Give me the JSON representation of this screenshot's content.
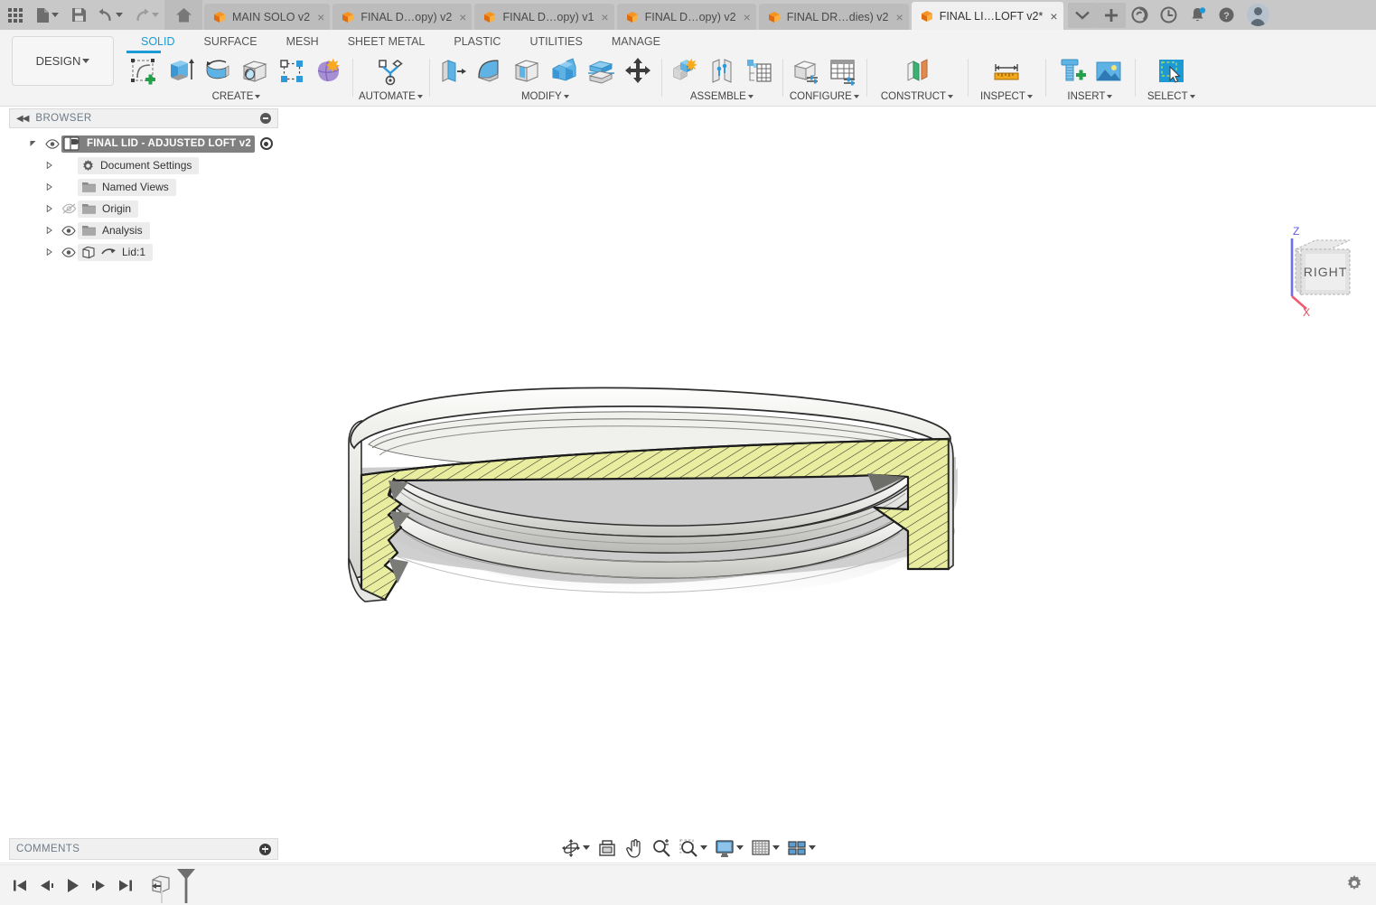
{
  "app": {
    "title": "Fusion 360",
    "accent_blue": "#1b9ad6",
    "chrome_gray": "#c8c8c8",
    "ribbon_bg": "#f3f3f3"
  },
  "quick_access": {
    "app_grid_label": "app-grid",
    "new_label": "New",
    "save_label": "Save",
    "undo_label": "Undo",
    "redo_label": "Redo",
    "home_label": "Home"
  },
  "tabs": [
    {
      "label": "MAIN SOLO v2",
      "active": false,
      "close": "×"
    },
    {
      "label": "FINAL D…opy) v2",
      "active": false,
      "close": "×"
    },
    {
      "label": "FINAL D…opy) v1",
      "active": false,
      "close": "×"
    },
    {
      "label": "FINAL D…opy) v2",
      "active": false,
      "close": "×"
    },
    {
      "label": "FINAL DR…dies) v2",
      "active": false,
      "close": "×"
    },
    {
      "label": "FINAL LI…LOFT v2*",
      "active": true,
      "close": "×"
    }
  ],
  "tab_overflow": {
    "chevron_label": "More tabs",
    "add_label": "New design"
  },
  "account_bar": {
    "extension_label": "Extensions",
    "recent_label": "Recent",
    "notifications_label": "Notifications",
    "help_label": "Help",
    "profile_label": "Account"
  },
  "design_menu": {
    "label": "DESIGN"
  },
  "ribbon_tabs": [
    {
      "label": "SOLID",
      "active": true
    },
    {
      "label": "SURFACE",
      "active": false
    },
    {
      "label": "MESH",
      "active": false
    },
    {
      "label": "SHEET METAL",
      "active": false
    },
    {
      "label": "PLASTIC",
      "active": false
    },
    {
      "label": "UTILITIES",
      "active": false
    },
    {
      "label": "MANAGE",
      "active": false
    }
  ],
  "ribbon_panels": [
    {
      "label": "CREATE",
      "has_caret": true,
      "tools": [
        {
          "name": "create-sketch",
          "label": "Create Sketch"
        },
        {
          "name": "extrude",
          "label": "Extrude"
        },
        {
          "name": "revolve",
          "label": "Revolve"
        },
        {
          "name": "hole",
          "label": "Hole"
        },
        {
          "name": "rectangular-pattern",
          "label": "Rectangular Pattern"
        },
        {
          "name": "form",
          "label": "Create Form"
        }
      ]
    },
    {
      "label": "AUTOMATE",
      "has_caret": true,
      "tools": [
        {
          "name": "automate",
          "label": "Automated Modeling"
        }
      ]
    },
    {
      "label": "MODIFY",
      "has_caret": true,
      "tools": [
        {
          "name": "press-pull",
          "label": "Press Pull"
        },
        {
          "name": "fillet",
          "label": "Fillet"
        },
        {
          "name": "shell",
          "label": "Shell"
        },
        {
          "name": "combine",
          "label": "Combine"
        },
        {
          "name": "split-body",
          "label": "Split Body"
        },
        {
          "name": "move-copy",
          "label": "Move/Copy"
        }
      ]
    },
    {
      "label": "ASSEMBLE",
      "has_caret": true,
      "tools": [
        {
          "name": "new-component",
          "label": "New Component"
        },
        {
          "name": "joint",
          "label": "Joint"
        },
        {
          "name": "bill-of-materials",
          "label": "Bill of Materials"
        }
      ]
    },
    {
      "label": "CONFIGURE",
      "has_caret": true,
      "tools": [
        {
          "name": "create-configuration",
          "label": "Create Configuration"
        },
        {
          "name": "configuration-table",
          "label": "Configuration Table"
        }
      ]
    },
    {
      "label": "CONSTRUCT",
      "has_caret": true,
      "tools": [
        {
          "name": "offset-plane",
          "label": "Offset Plane"
        }
      ]
    },
    {
      "label": "INSPECT",
      "has_caret": true,
      "tools": [
        {
          "name": "measure",
          "label": "Measure"
        }
      ]
    },
    {
      "label": "INSERT",
      "has_caret": true,
      "tools": [
        {
          "name": "insert-mcmaster-carr",
          "label": "Insert McMaster-Carr Component"
        },
        {
          "name": "canvas",
          "label": "Canvas"
        }
      ]
    },
    {
      "label": "SELECT",
      "has_caret": true,
      "tools": [
        {
          "name": "select",
          "label": "Select"
        }
      ]
    }
  ],
  "browser": {
    "title": "BROWSER",
    "collapse_label": "◀◀",
    "tree": [
      {
        "label": "FINAL LID - ADJUSTED LOFT v2",
        "level": 0,
        "icon": "component-icon",
        "visible": true,
        "has_radio": true,
        "expanded": true,
        "root": true
      },
      {
        "label": "Document Settings",
        "level": 1,
        "icon": "gear-icon",
        "visible": null,
        "expanded": false
      },
      {
        "label": "Named Views",
        "level": 1,
        "icon": "folder-icon",
        "visible": null,
        "expanded": false
      },
      {
        "label": "Origin",
        "level": 1,
        "icon": "folder-icon",
        "visible": false,
        "expanded": false
      },
      {
        "label": "Analysis",
        "level": 1,
        "icon": "folder-icon",
        "visible": true,
        "expanded": false
      },
      {
        "label": "Lid:1",
        "level": 1,
        "icon": "body-icon",
        "visible": true,
        "expanded": false,
        "has_joint": true
      }
    ]
  },
  "viewcube": {
    "face_label": "RIGHT",
    "axis_z": "Z",
    "axis_x": "X"
  },
  "model": {
    "name": "lid-section-view",
    "description": "Sectioned circular lid with threaded inner profile",
    "section_fill": "#e9eda0",
    "body_fill": "#f2f2f0",
    "shadow": "#cccccc"
  },
  "nav_toolbar": [
    {
      "name": "orbit-icon",
      "label": "Orbit",
      "caret": true
    },
    {
      "name": "look-at-icon",
      "label": "Look At",
      "caret": false
    },
    {
      "name": "pan-icon",
      "label": "Pan",
      "caret": false
    },
    {
      "name": "zoom-icon",
      "label": "Zoom",
      "caret": false
    },
    {
      "name": "zoom-window-icon",
      "label": "Fit",
      "caret": true
    },
    {
      "name": "display-settings-icon",
      "label": "Display Settings",
      "caret": true
    },
    {
      "name": "grid-snap-icon",
      "label": "Grid and Snaps",
      "caret": true
    },
    {
      "name": "viewports-icon",
      "label": "Viewports",
      "caret": true
    }
  ],
  "comments": {
    "title": "COMMENTS",
    "add_label": "+"
  },
  "timeline": {
    "controls": [
      {
        "name": "go-to-beginning-icon",
        "label": "Go to beginning"
      },
      {
        "name": "step-back-icon",
        "label": "Step back"
      },
      {
        "name": "play-icon",
        "label": "Play"
      },
      {
        "name": "step-forward-icon",
        "label": "Step forward"
      },
      {
        "name": "go-to-end-icon",
        "label": "Go to end"
      }
    ],
    "features": [
      {
        "name": "loft-feature",
        "label": "Loft"
      }
    ],
    "settings_label": "Timeline settings"
  }
}
